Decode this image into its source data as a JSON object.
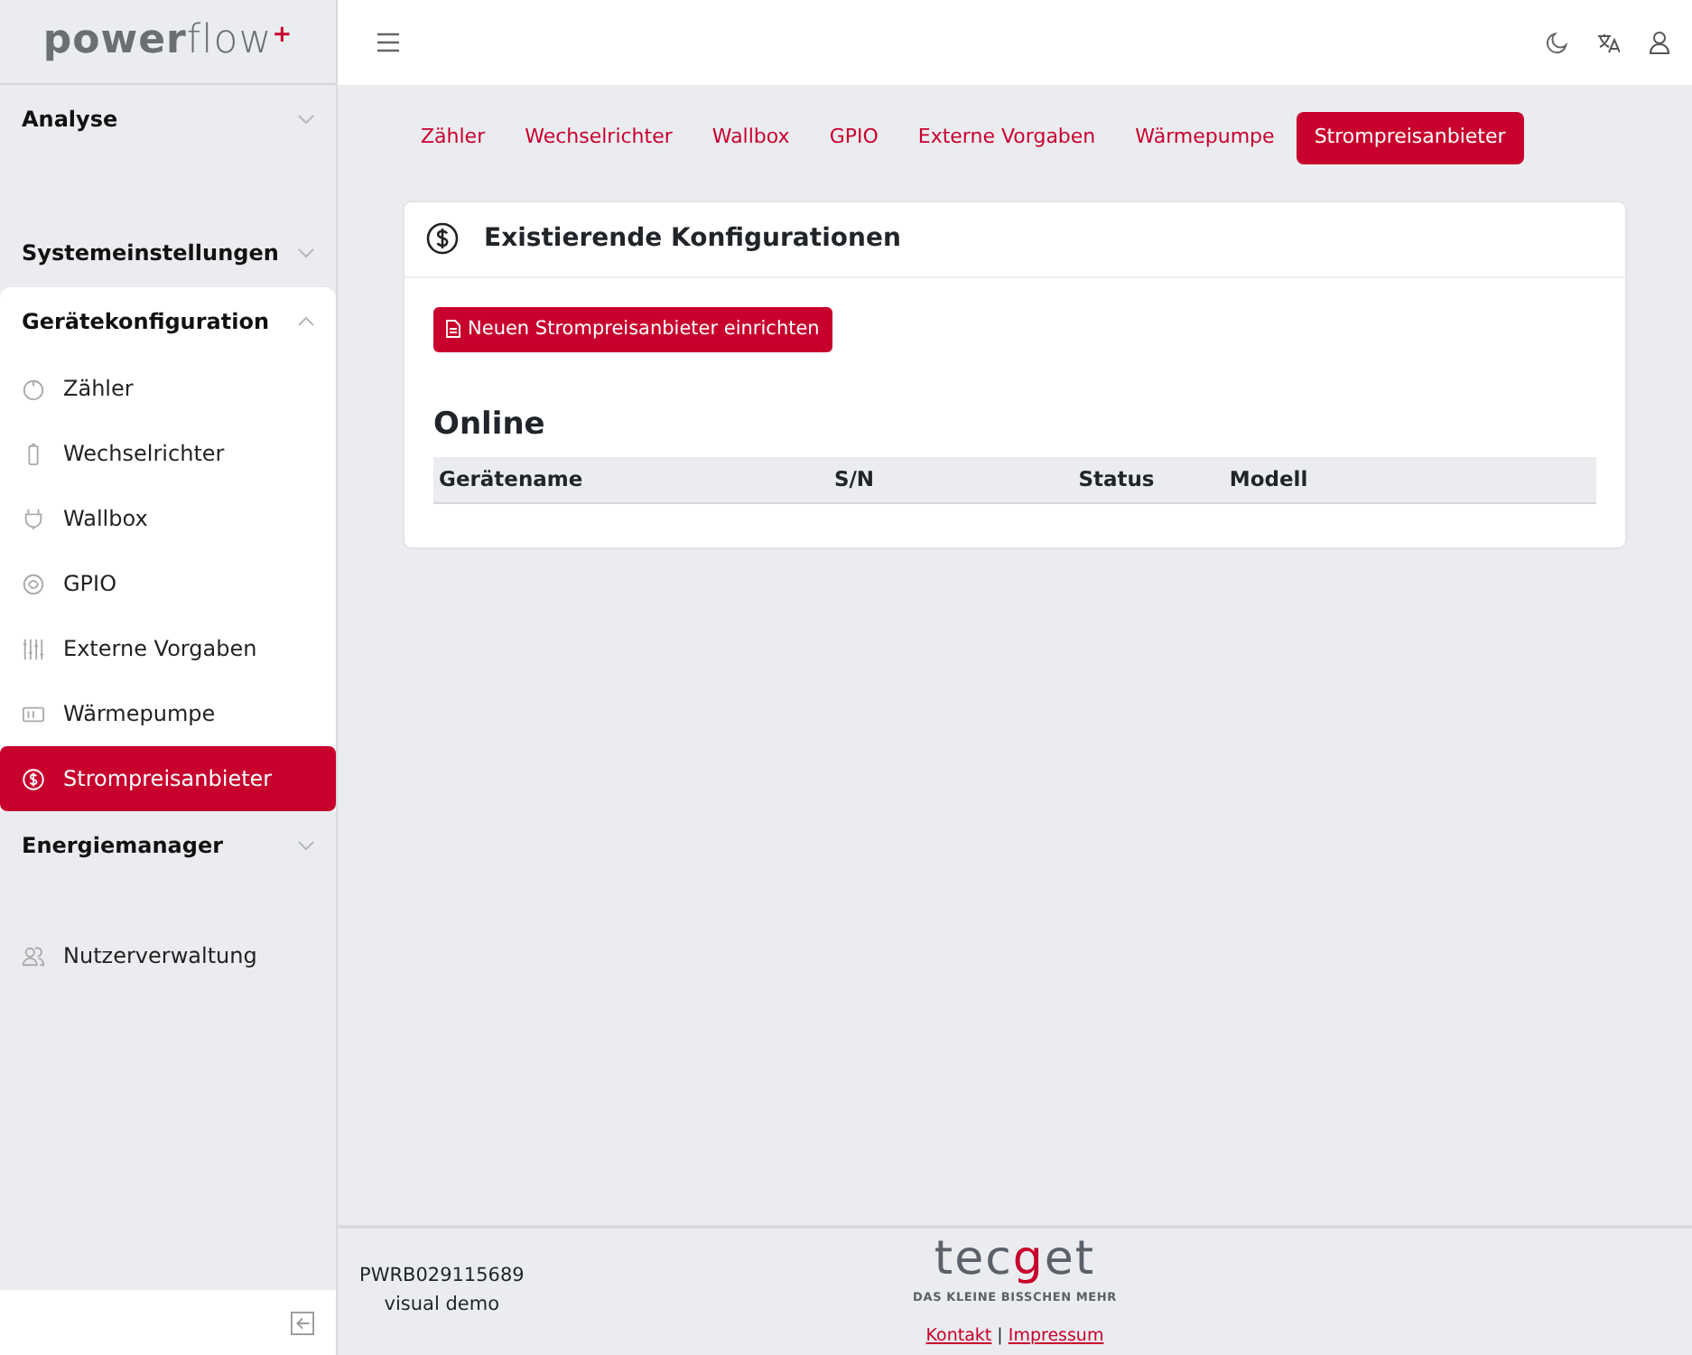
{
  "sidebar": {
    "logo": "**power**flow$^{+}$",
    "sections": [
      {
        "kind": "group",
        "label": "Analyse",
        "expanded": false
      },
      {
        "kind": "group",
        "label": "Systemeinstellungen",
        "expanded": false
      },
      {
        "kind": "group",
        "label": "Gerätekonfiguration",
        "expanded": true,
        "children": [
          {
            "label": "Zähler",
            "selected": false
          },
          {
            "label": "Wechselrichter",
            "selected": false
          },
          {
            "label": "Wallbox",
            "selected": false
          },
          {
            "label": "GPIO",
            "selected": false
          },
          {
            "label": "Externe Vorgaben",
            "selected": false
          },
          {
            "label": "Wärmepumpe",
            "selected": false
          },
          {
            "label": "Strompreisanbieter",
            "selected": true
          }
        ]
      },
      {
        "kind": "group",
        "label": "Energiemanager",
        "expanded": false
      },
      {
        "kind": "link",
        "label": "Nutzerverwaltung"
      }
    ]
  },
  "tabs": [
    {
      "label": "Zähler",
      "selected": false
    },
    {
      "label": "Wechselrichter",
      "selected": false
    },
    {
      "label": "Wallbox",
      "selected": false
    },
    {
      "label": "GPIO",
      "selected": false
    },
    {
      "label": "Externe Vorgaben",
      "selected": false
    },
    {
      "label": "Wärmepumpe",
      "selected": false
    },
    {
      "label": "Strompreisanbieter",
      "selected": true
    }
  ],
  "card": {
    "title": "Existierende Konfigurationen",
    "button": "Neuen Strompreisanbieter einrichten",
    "section_title": "Online",
    "table": {
      "columns": [
        "Gerätename",
        "S/N",
        "Status",
        "Modell"
      ]
    }
  },
  "footer": {
    "device": "PWRB029115689",
    "mode": "visual demo",
    "logo": {
      "parts": [
        {
          "text": "tec",
          "accent": false
        },
        {
          "text": "g",
          "accent": true
        },
        {
          "text": "et",
          "accent": false
        }
      ],
      "tagline": "DAS KLEINE BISSCHEN MEHR"
    },
    "links": [
      "Kontakt",
      "Impressum"
    ],
    "separator": "|"
  }
}
